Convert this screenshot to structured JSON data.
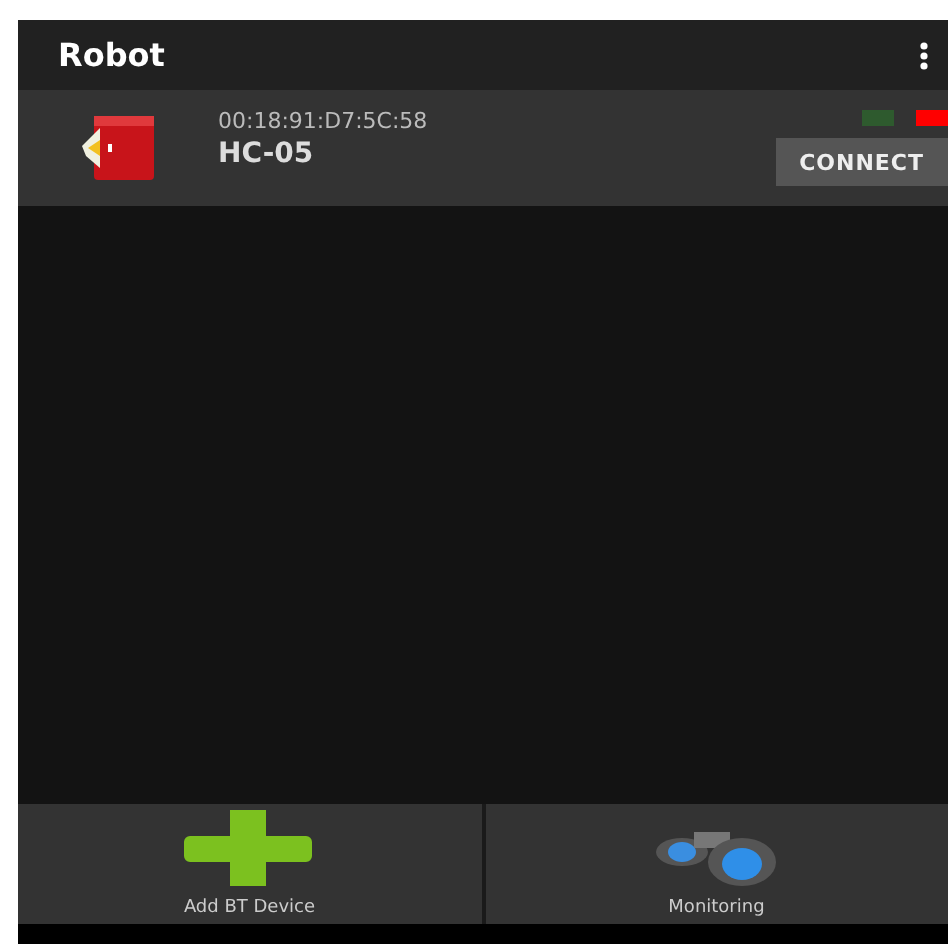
{
  "app_bar": {
    "title": "Robot"
  },
  "devices": [
    {
      "address": "00:18:91:D7:5C:58",
      "name": "HC-05",
      "button": "CONNECT",
      "indicators": [
        {
          "color": "#2e5a2e"
        },
        {
          "color": "#ff0000"
        }
      ]
    }
  ],
  "bottom_buttons": [
    {
      "kind": "add",
      "label": "Add BT Device"
    },
    {
      "kind": "monitor",
      "label": "Monitoring"
    }
  ]
}
